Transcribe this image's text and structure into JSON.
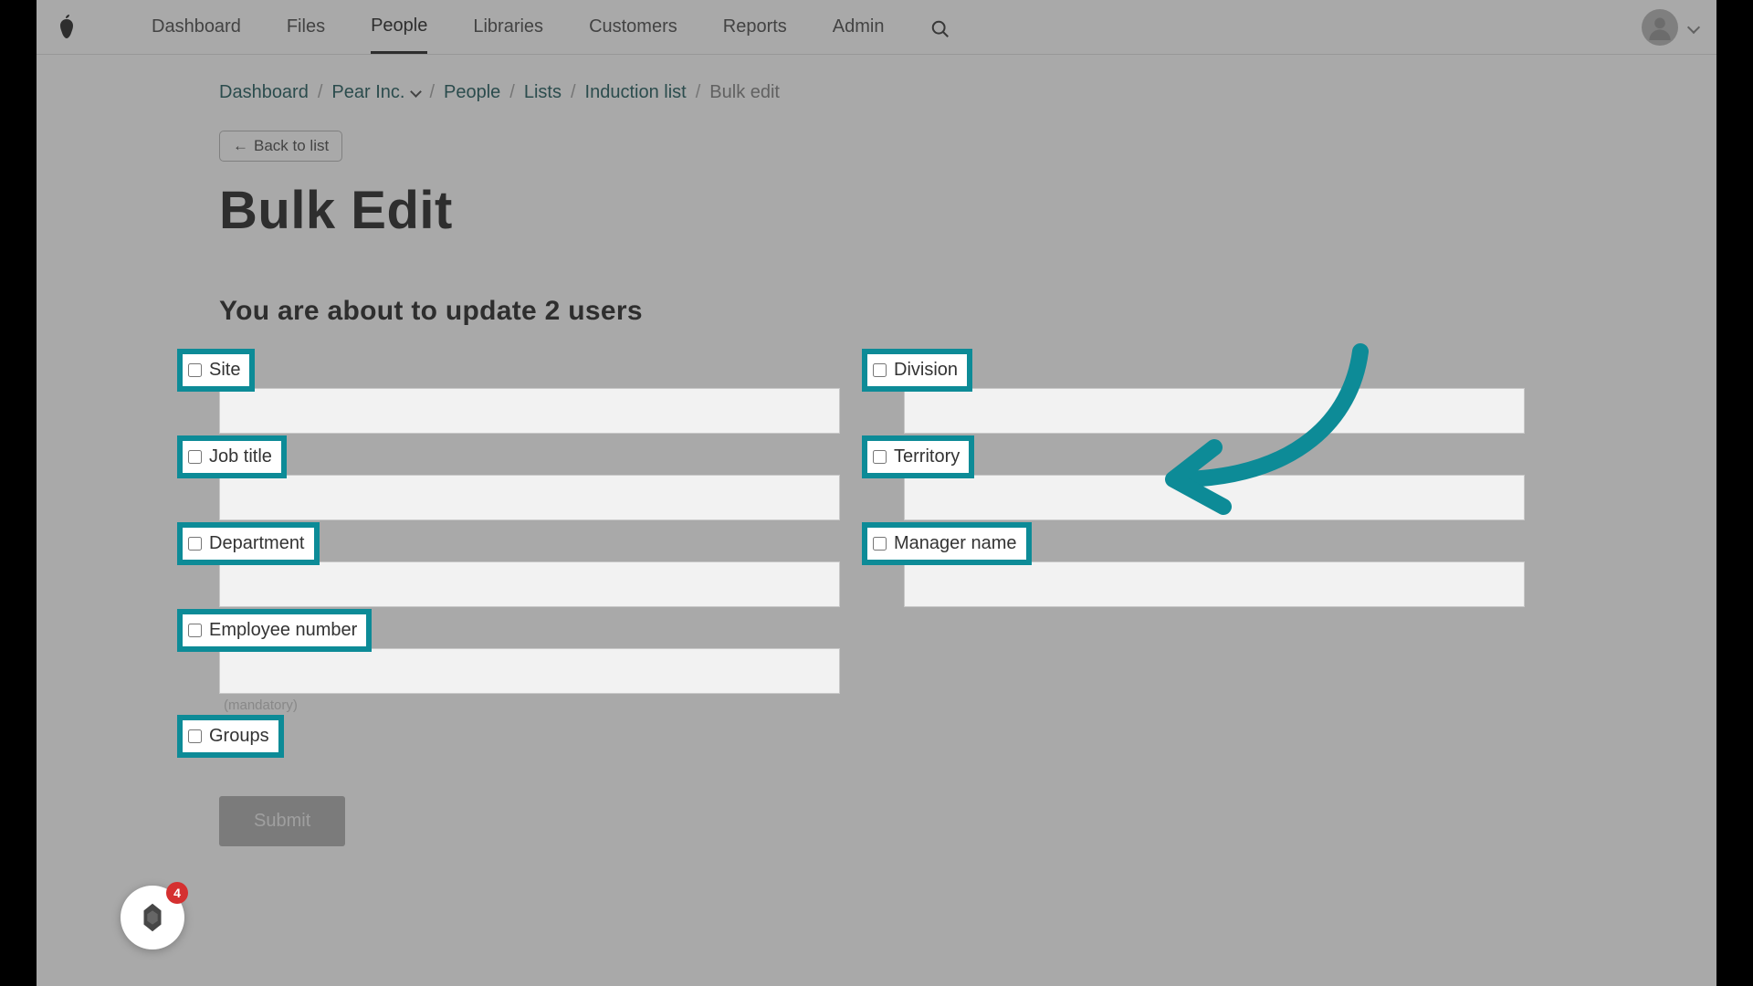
{
  "nav": {
    "items": [
      "Dashboard",
      "Files",
      "People",
      "Libraries",
      "Customers",
      "Reports",
      "Admin"
    ],
    "active_index": 2
  },
  "breadcrumbs": {
    "items": [
      {
        "label": "Dashboard",
        "link": true,
        "dropdown": false
      },
      {
        "label": "Pear Inc.",
        "link": true,
        "dropdown": true
      },
      {
        "label": "People",
        "link": true,
        "dropdown": false
      },
      {
        "label": "Lists",
        "link": true,
        "dropdown": false
      },
      {
        "label": "Induction list",
        "link": true,
        "dropdown": false
      },
      {
        "label": "Bulk edit",
        "link": false,
        "dropdown": false
      }
    ]
  },
  "buttons": {
    "back": "Back to list",
    "submit": "Submit"
  },
  "page": {
    "title": "Bulk Edit",
    "subtitle": "You are about to update 2 users"
  },
  "fields": {
    "left": [
      {
        "label": "Site",
        "checked": false,
        "helper": null
      },
      {
        "label": "Job title",
        "checked": false,
        "helper": null
      },
      {
        "label": "Department",
        "checked": false,
        "helper": null
      },
      {
        "label": "Employee number",
        "checked": false,
        "helper": "(mandatory)"
      },
      {
        "label": "Groups",
        "checked": false,
        "helper": null,
        "no_input": true
      }
    ],
    "right": [
      {
        "label": "Division",
        "checked": false,
        "helper": null
      },
      {
        "label": "Territory",
        "checked": false,
        "helper": null
      },
      {
        "label": "Manager name",
        "checked": false,
        "helper": null
      }
    ]
  },
  "widget": {
    "badge_count": "4"
  },
  "colors": {
    "highlight": "#0d8b97",
    "breadcrumb_link": "#2e6466"
  }
}
